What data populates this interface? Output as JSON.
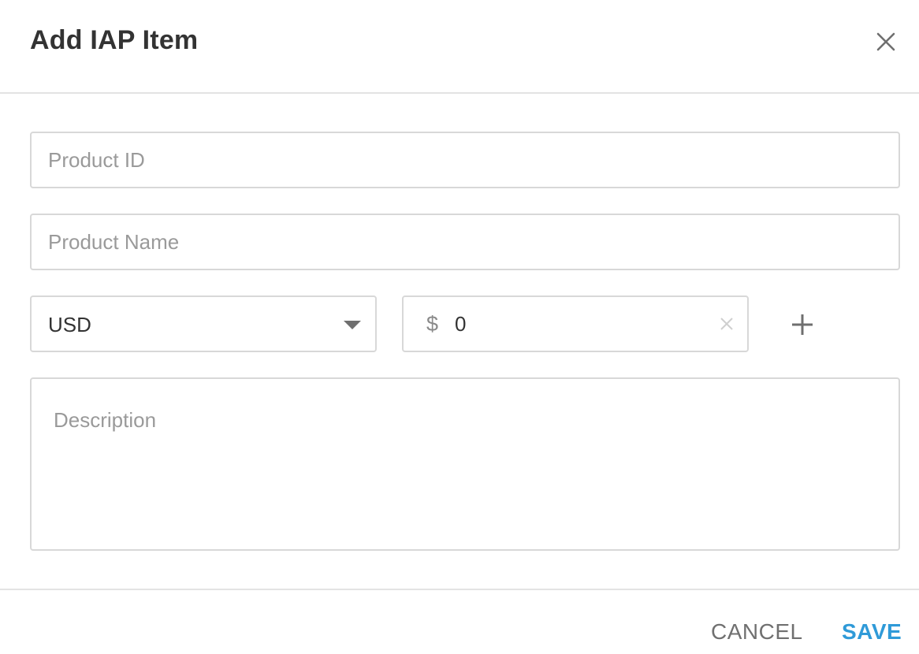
{
  "dialog": {
    "title": "Add IAP Item",
    "close_icon": "close-icon"
  },
  "form": {
    "product_id": {
      "placeholder": "Product ID",
      "value": ""
    },
    "product_name": {
      "placeholder": "Product Name",
      "value": ""
    },
    "currency": {
      "selected": "USD",
      "icon": "chevron-down-icon"
    },
    "price": {
      "symbol": "$",
      "value": "0",
      "clear_icon": "clear-icon"
    },
    "add_price_icon": "plus-icon",
    "description": {
      "placeholder": "Description",
      "value": ""
    }
  },
  "footer": {
    "cancel_label": "CANCEL",
    "save_label": "SAVE"
  },
  "colors": {
    "accent": "#2f9ad8",
    "border": "#d8d8d8",
    "divider": "#e3e3e3",
    "title": "#333333",
    "placeholder": "#9a9a9a"
  }
}
